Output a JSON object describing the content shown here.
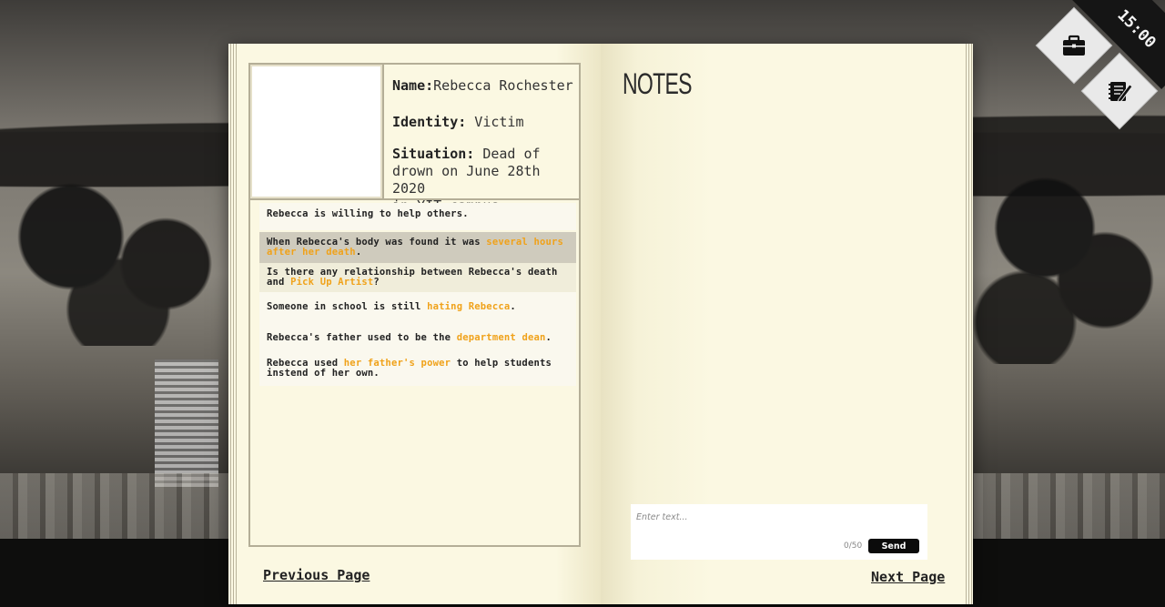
{
  "hud": {
    "timer": "15:00",
    "icons": [
      "briefcase-icon",
      "notebook-pencil-icon"
    ]
  },
  "profile": {
    "name_label": "Name:",
    "name_value": "Rebecca Rochester",
    "identity_label": "Identity:",
    "identity_value": " Victim",
    "situation_label": "Situation:",
    "situation_value_1": " Dead of",
    "situation_value_2": "drown on June 28th 2020",
    "situation_value_3": "in YIT campus"
  },
  "clues": [
    {
      "pre": "Rebecca is willing to help others.",
      "hl": "",
      "post": ""
    },
    {
      "pre": "When Rebecca's body was found it was ",
      "hl": "several hours after her death",
      "post": "."
    },
    {
      "pre": "Is there any relationship between Rebecca's death and ",
      "hl": "Pick Up Artist",
      "post": "?"
    },
    {
      "pre": "Someone in school is still ",
      "hl": "hating Rebecca",
      "post": "."
    },
    {
      "pre": "Rebecca's father used to be the ",
      "hl": "department dean",
      "post": "."
    },
    {
      "pre": "Rebecca used ",
      "hl": "her father's power",
      "post": " to help students instend of her own."
    }
  ],
  "nav": {
    "previous": "Previous Page",
    "next": "Next Page"
  },
  "notes": {
    "title": "NOTES",
    "input_placeholder": "Enter text...",
    "input_value": "",
    "counter": "0/50",
    "send_label": "Send"
  },
  "colors": {
    "highlight": "#f0a21a",
    "page": "#fbf8e2",
    "selected_row": "#cfcbbd"
  }
}
